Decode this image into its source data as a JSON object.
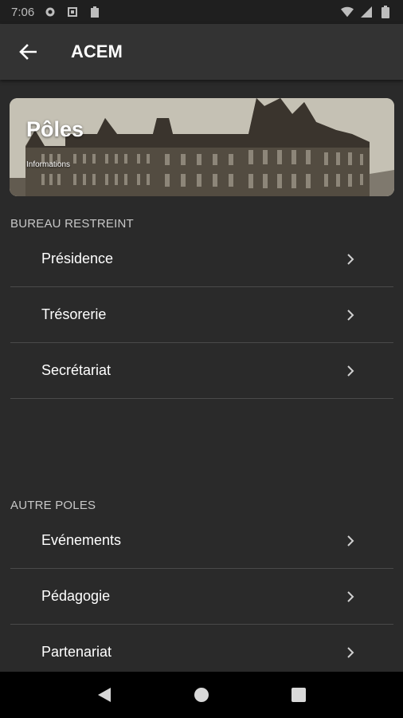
{
  "status_bar": {
    "time": "7:06"
  },
  "app_bar": {
    "title": "ACEM"
  },
  "banner": {
    "title": "Pôles",
    "subtitle": "Informations"
  },
  "sections": {
    "bureau": {
      "header": "BUREAU RESTREINT",
      "items": [
        {
          "label": "Présidence"
        },
        {
          "label": "Trésorerie"
        },
        {
          "label": "Secrétariat"
        }
      ]
    },
    "autre": {
      "header": "AUTRE POLES",
      "items": [
        {
          "label": "Evénements"
        },
        {
          "label": "Pédagogie"
        },
        {
          "label": "Partenariat"
        }
      ]
    }
  },
  "colors": {
    "background": "#2a2a2a",
    "app_bar": "#333333",
    "divider": "#4a4a4a",
    "nav_bar": "#000000"
  }
}
